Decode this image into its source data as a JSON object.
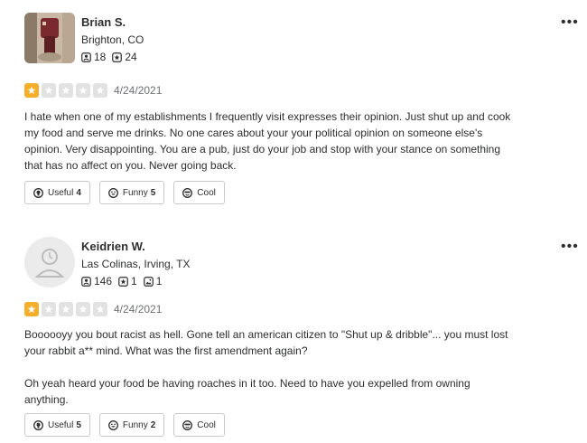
{
  "reviews": [
    {
      "user": {
        "name": "Brian S.",
        "location": "Brighton, CO",
        "stats": {
          "friends": "18",
          "reviews": "24"
        }
      },
      "rating": 1,
      "max_rating": 5,
      "date": "4/24/2021",
      "paragraphs": [
        "I hate when one of my establishments I frequently visit expresses their opinion.  Just shut up and cook my food and serve me drinks. No one cares about your your political opinion on someone else's opinion. Very disappointing. You are a pub, just do your job and stop with your stance on something that has no affect on you. Never going back."
      ],
      "actions": {
        "useful_label": "Useful",
        "useful_count": "4",
        "funny_label": "Funny",
        "funny_count": "5",
        "cool_label": "Cool"
      },
      "more_label": "•••"
    },
    {
      "user": {
        "name": "Keidrien W.",
        "location": "Las Colinas, Irving, TX",
        "stats": {
          "friends": "146",
          "reviews": "1",
          "photos": "1"
        }
      },
      "rating": 1,
      "max_rating": 5,
      "date": "4/24/2021",
      "paragraphs": [
        "Boooooyy you bout racist as hell. Gone tell an american citizen to \"Shut up & dribble\"... you must lost your rabbit a** mind. What was the first amendment again?",
        "Oh yeah heard your food be having roaches in it too. Need to have you expelled from owning anything."
      ],
      "actions": {
        "useful_label": "Useful",
        "useful_count": "5",
        "funny_label": "Funny",
        "funny_count": "2",
        "cool_label": "Cool"
      },
      "more_label": "•••"
    }
  ],
  "colors": {
    "star_filled": "#f5ae2a",
    "star_empty": "#e2e2e2",
    "text": "#2d2e2f",
    "muted": "#6e7072"
  }
}
